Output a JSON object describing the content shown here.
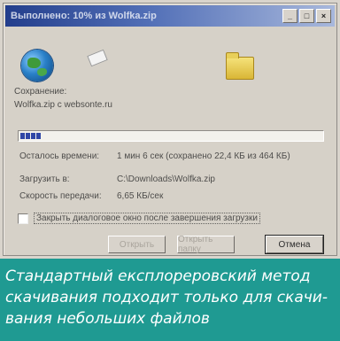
{
  "window": {
    "title": "Выполнено: 10% из Wolfka.zip",
    "minimize_glyph": "_",
    "maximize_glyph": "□",
    "close_glyph": "×"
  },
  "icons": {
    "globe": "globe-icon",
    "document": "flying-document-icon",
    "folder": "folder-icon"
  },
  "status": {
    "line1": "Сохранение:",
    "line2": "Wolfka.zip с websonte.ru"
  },
  "progress": {
    "fraction": 0.1,
    "segments": 4
  },
  "details": [
    {
      "label": "Осталось времени:",
      "value": "1 мин 6 сек (сохранено 22,4 КБ из 464 КБ)"
    },
    {
      "label": "Загрузить в:",
      "value": "C:\\Downloads\\Wolfka.zip"
    },
    {
      "label": "Скорость передачи:",
      "value": "6,65 КБ/сек"
    }
  ],
  "checkbox": {
    "label": "Закрыть диалоговое окно после завершения загрузки",
    "checked": false
  },
  "buttons": {
    "open": "Открыть",
    "open_folder": "Открыть папку",
    "cancel": "Отмена"
  },
  "caption": {
    "lines": [
      "Стандартный експлореровский метод",
      "скачивания подходит только для скачи-",
      "вания небольших файлов"
    ]
  },
  "colors": {
    "title_bar": "#233e8c",
    "progress": "#2f46a6",
    "caption_bg": "#1f9a92"
  }
}
